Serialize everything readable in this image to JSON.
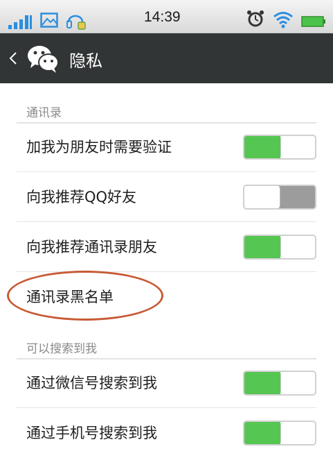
{
  "status_bar": {
    "time": "14:39",
    "icons": [
      "signal-icon",
      "image-icon",
      "headset-icon",
      "alarm-icon",
      "wifi-icon",
      "battery-icon"
    ],
    "accent_color": "#2a8ee0"
  },
  "nav": {
    "title": "隐私",
    "back_icon": "chevron-left-icon",
    "logo_icon": "wechat-icon"
  },
  "sections": {
    "contacts": {
      "header": "通讯录",
      "items": [
        {
          "label": "加我为朋友时需要验证",
          "toggle": "on"
        },
        {
          "label": "向我推荐QQ好友",
          "toggle": "off"
        },
        {
          "label": "向我推荐通讯录朋友",
          "toggle": "on"
        },
        {
          "label": "通讯录黑名单"
        }
      ]
    },
    "search": {
      "header": "可以搜索到我",
      "items": [
        {
          "label": "通过微信号搜索到我",
          "toggle": "on"
        },
        {
          "label": "通过手机号搜索到我",
          "toggle": "on"
        }
      ]
    }
  },
  "colors": {
    "toggle_on": "#55c652",
    "toggle_off": "#9c9c9c",
    "nav_background": "#323535",
    "annotation": "#c75a35"
  }
}
